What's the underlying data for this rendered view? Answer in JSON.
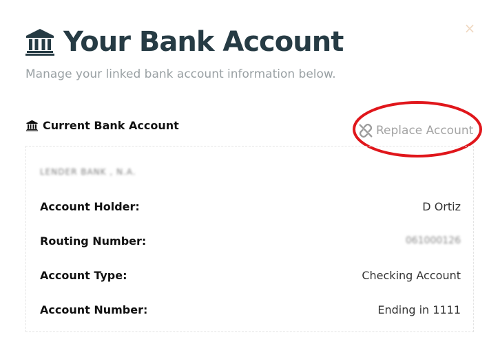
{
  "modal": {
    "title": "Your Bank Account",
    "subtitle": "Manage your linked bank account information below.",
    "close_symbol": "×"
  },
  "section": {
    "label": "Current Bank Account",
    "icon": "bank-icon"
  },
  "replace": {
    "label": "Replace Account",
    "icon": "unlink-icon",
    "highlight_color": "#e0161b"
  },
  "account": {
    "bank_name": "LENDER BANK , N.A.",
    "rows": [
      {
        "label": "Account Holder:",
        "value": "D Ortiz"
      },
      {
        "label": "Routing Number:",
        "value": "061000126"
      },
      {
        "label": "Account Type:",
        "value": "Checking Account"
      },
      {
        "label": "Account Number:",
        "value": "Ending in 1111"
      }
    ]
  },
  "colors": {
    "title": "#263b44",
    "subtitle": "#9aa1a4",
    "link": "#a4a4a4"
  }
}
